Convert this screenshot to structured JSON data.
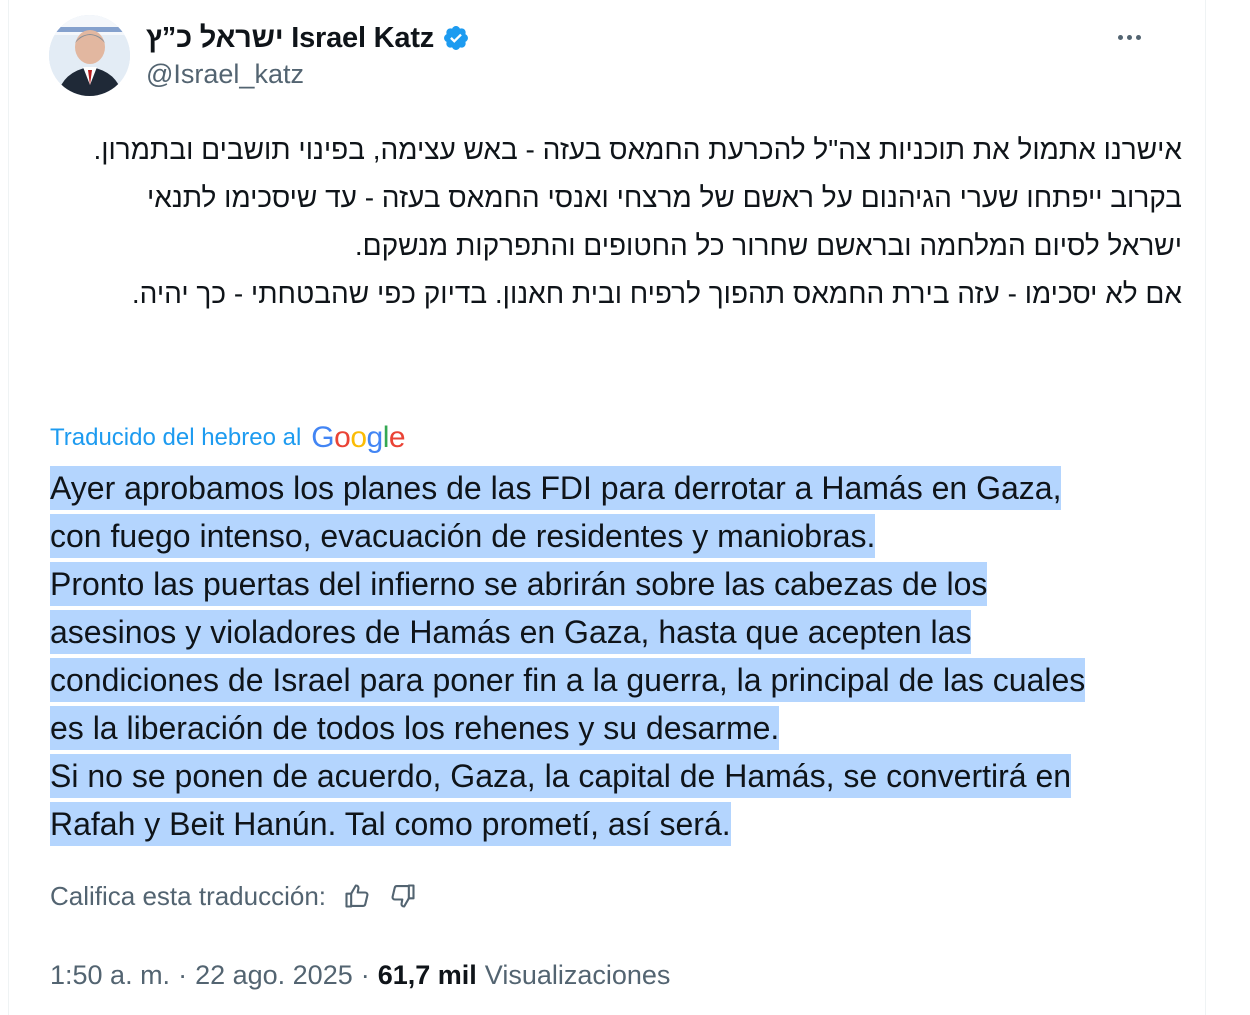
{
  "author": {
    "display_name": "ישראל כ”ץ Israel Katz",
    "handle": "@Israel_katz"
  },
  "icons": {
    "avatar": "profile-photo",
    "verified": "verified-badge-icon",
    "more": "more-options-icon",
    "thumbs_up": "thumbs-up-icon",
    "thumbs_down": "thumbs-down-icon"
  },
  "tweet": {
    "hebrew_lines": [
      "אישרנו אתמול את תוכניות צה\"ל להכרעת החמאס בעזה - באש עצימה, בפינוי תושבים ובתמרון.",
      "בקרוב ייפתחו שערי הגיהנום על ראשם של מרצחי ואנסי החמאס בעזה - עד שיסכימו לתנאי ישראל לסיום המלחמה ובראשם שחרור כל החטופים והתפרקות מנשקם.",
      "אם לא יסכימו - עזה בירת החמאס תהפוך לרפיח ובית חאנון. בדיוק כפי שהבטחתי - כך יהיה."
    ],
    "translated_label": "Traducido del hebreo al",
    "translator_brand": "Google",
    "spanish_lines": [
      "Ayer aprobamos los planes de las FDI para derrotar a Hamás en Gaza,",
      "con fuego intenso, evacuación de residentes y maniobras.",
      "Pronto las puertas del infierno se abrirán sobre las cabezas de los",
      "asesinos y violadores de Hamás en Gaza, hasta que acepten las",
      "condiciones de Israel para poner fin a la guerra, la principal de las cuales",
      "es la liberación de todos los rehenes y su desarme.",
      "Si no se ponen de acuerdo, Gaza, la capital de Hamás, se convertirá en",
      "Rafah y Beit Hanún. Tal como prometí, así será."
    ],
    "rate_label": "Califica esta traducción:"
  },
  "meta": {
    "time": "1:50 a. m.",
    "separator": "·",
    "date": "22 ago. 2025",
    "views_count": "61,7 mil",
    "views_label": "Visualizaciones"
  },
  "colors": {
    "link_blue": "#1d9bf0",
    "selection_highlight": "#b4d5fe",
    "secondary_text": "#536471"
  }
}
